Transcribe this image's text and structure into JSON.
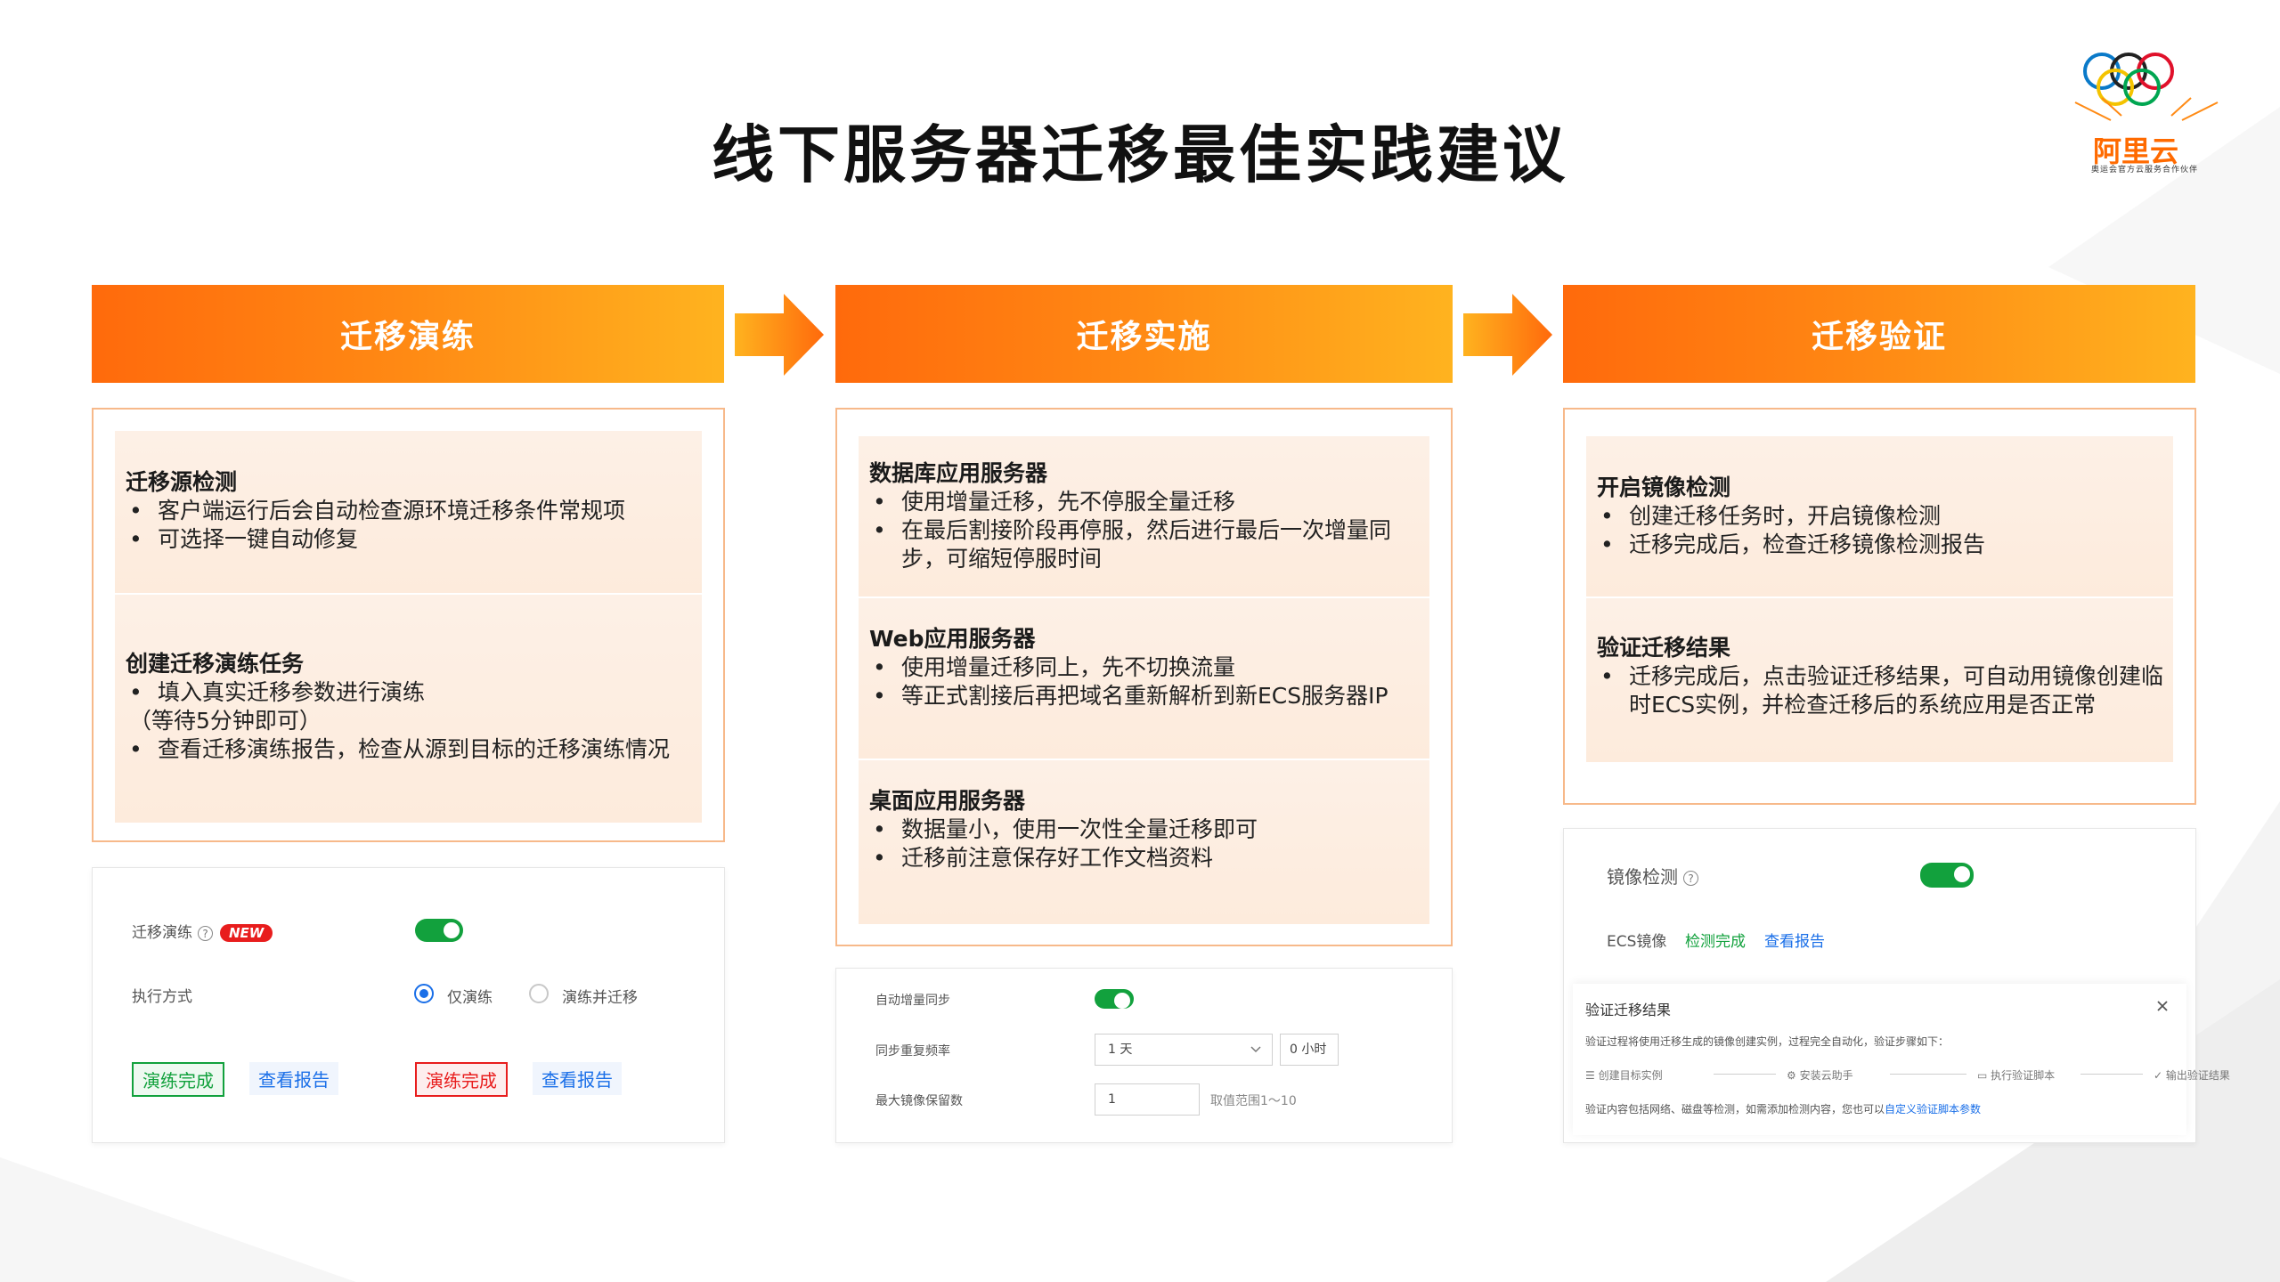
{
  "title": "线下服务器迁移最佳实践建议",
  "logo": {
    "text": "阿里云",
    "tagline": "奥运会官方云服务合作伙伴"
  },
  "steps": [
    "迁移演练",
    "迁移实施",
    "迁移验证"
  ],
  "col1": {
    "sections": [
      {
        "title": "迁移源检测",
        "bullets": [
          "客户端运行后会自动检查源环境迁移条件常规项",
          "可选择一键自动修复"
        ]
      },
      {
        "title": "创建迁移演练任务",
        "bullets": [
          "填入真实迁移参数进行演练",
          "查看迁移演练报告，检查从源到目标的迁移演练情况"
        ],
        "note": "（等待5分钟即可）"
      }
    ],
    "ui": {
      "label_drill": "迁移演练",
      "new_badge": "NEW",
      "label_mode": "执行方式",
      "radio1": "仅演练",
      "radio2": "演练并迁移",
      "tag_done": "演练完成",
      "link_report": "查看报告"
    }
  },
  "col2": {
    "sections": [
      {
        "title": "数据库应用服务器",
        "bullets": [
          "使用增量迁移，先不停服全量迁移",
          "在最后割接阶段再停服，然后进行最后一次增量同步，可缩短停服时间"
        ]
      },
      {
        "title": "Web应用服务器",
        "bullets": [
          "使用增量迁移同上，先不切换流量",
          "等正式割接后再把域名重新解析到新ECS服务器IP"
        ]
      },
      {
        "title": "桌面应用服务器",
        "bullets": [
          "数据量小，使用一次性全量迁移即可",
          "迁移前注意保存好工作文档资料"
        ]
      }
    ],
    "ui": {
      "label_auto_sync": "自动增量同步",
      "label_frequency": "同步重复频率",
      "freq_value": "1 天",
      "hours_value": "0 小时",
      "label_max_images": "最大镜像保留数",
      "max_value": "1",
      "range_hint": "取值范围1～10"
    }
  },
  "col3": {
    "sections": [
      {
        "title": "开启镜像检测",
        "bullets": [
          "创建迁移任务时，开启镜像检测",
          "迁移完成后，检查迁移镜像检测报告"
        ]
      },
      {
        "title": "验证迁移结果",
        "bullets": [
          "迁移完成后，点击验证迁移结果，可自动用镜像创建临时ECS实例，并检查迁移后的系统应用是否正常"
        ]
      }
    ],
    "ui": {
      "label_image_check": "镜像检测",
      "label_ecs_image": "ECS镜像",
      "status_done": "检测完成",
      "link_report": "查看报告",
      "dialog_title": "验证迁移结果",
      "dialog_desc": "验证过程将使用迁移生成的镜像创建实例，过程完全自动化，验证步骤如下：",
      "dialog_steps": [
        "创建目标实例",
        "安装云助手",
        "执行验证脚本",
        "输出验证结果"
      ],
      "dialog_footer": "验证内容包括网络、磁盘等检测，如需添加检测内容，您也可以",
      "dialog_footer_link": "自定义验证脚本参数"
    }
  },
  "colors": {
    "accent": "#ff6a00",
    "green": "#12a13d",
    "red": "#e81d1d",
    "link": "#1a6fe8"
  }
}
